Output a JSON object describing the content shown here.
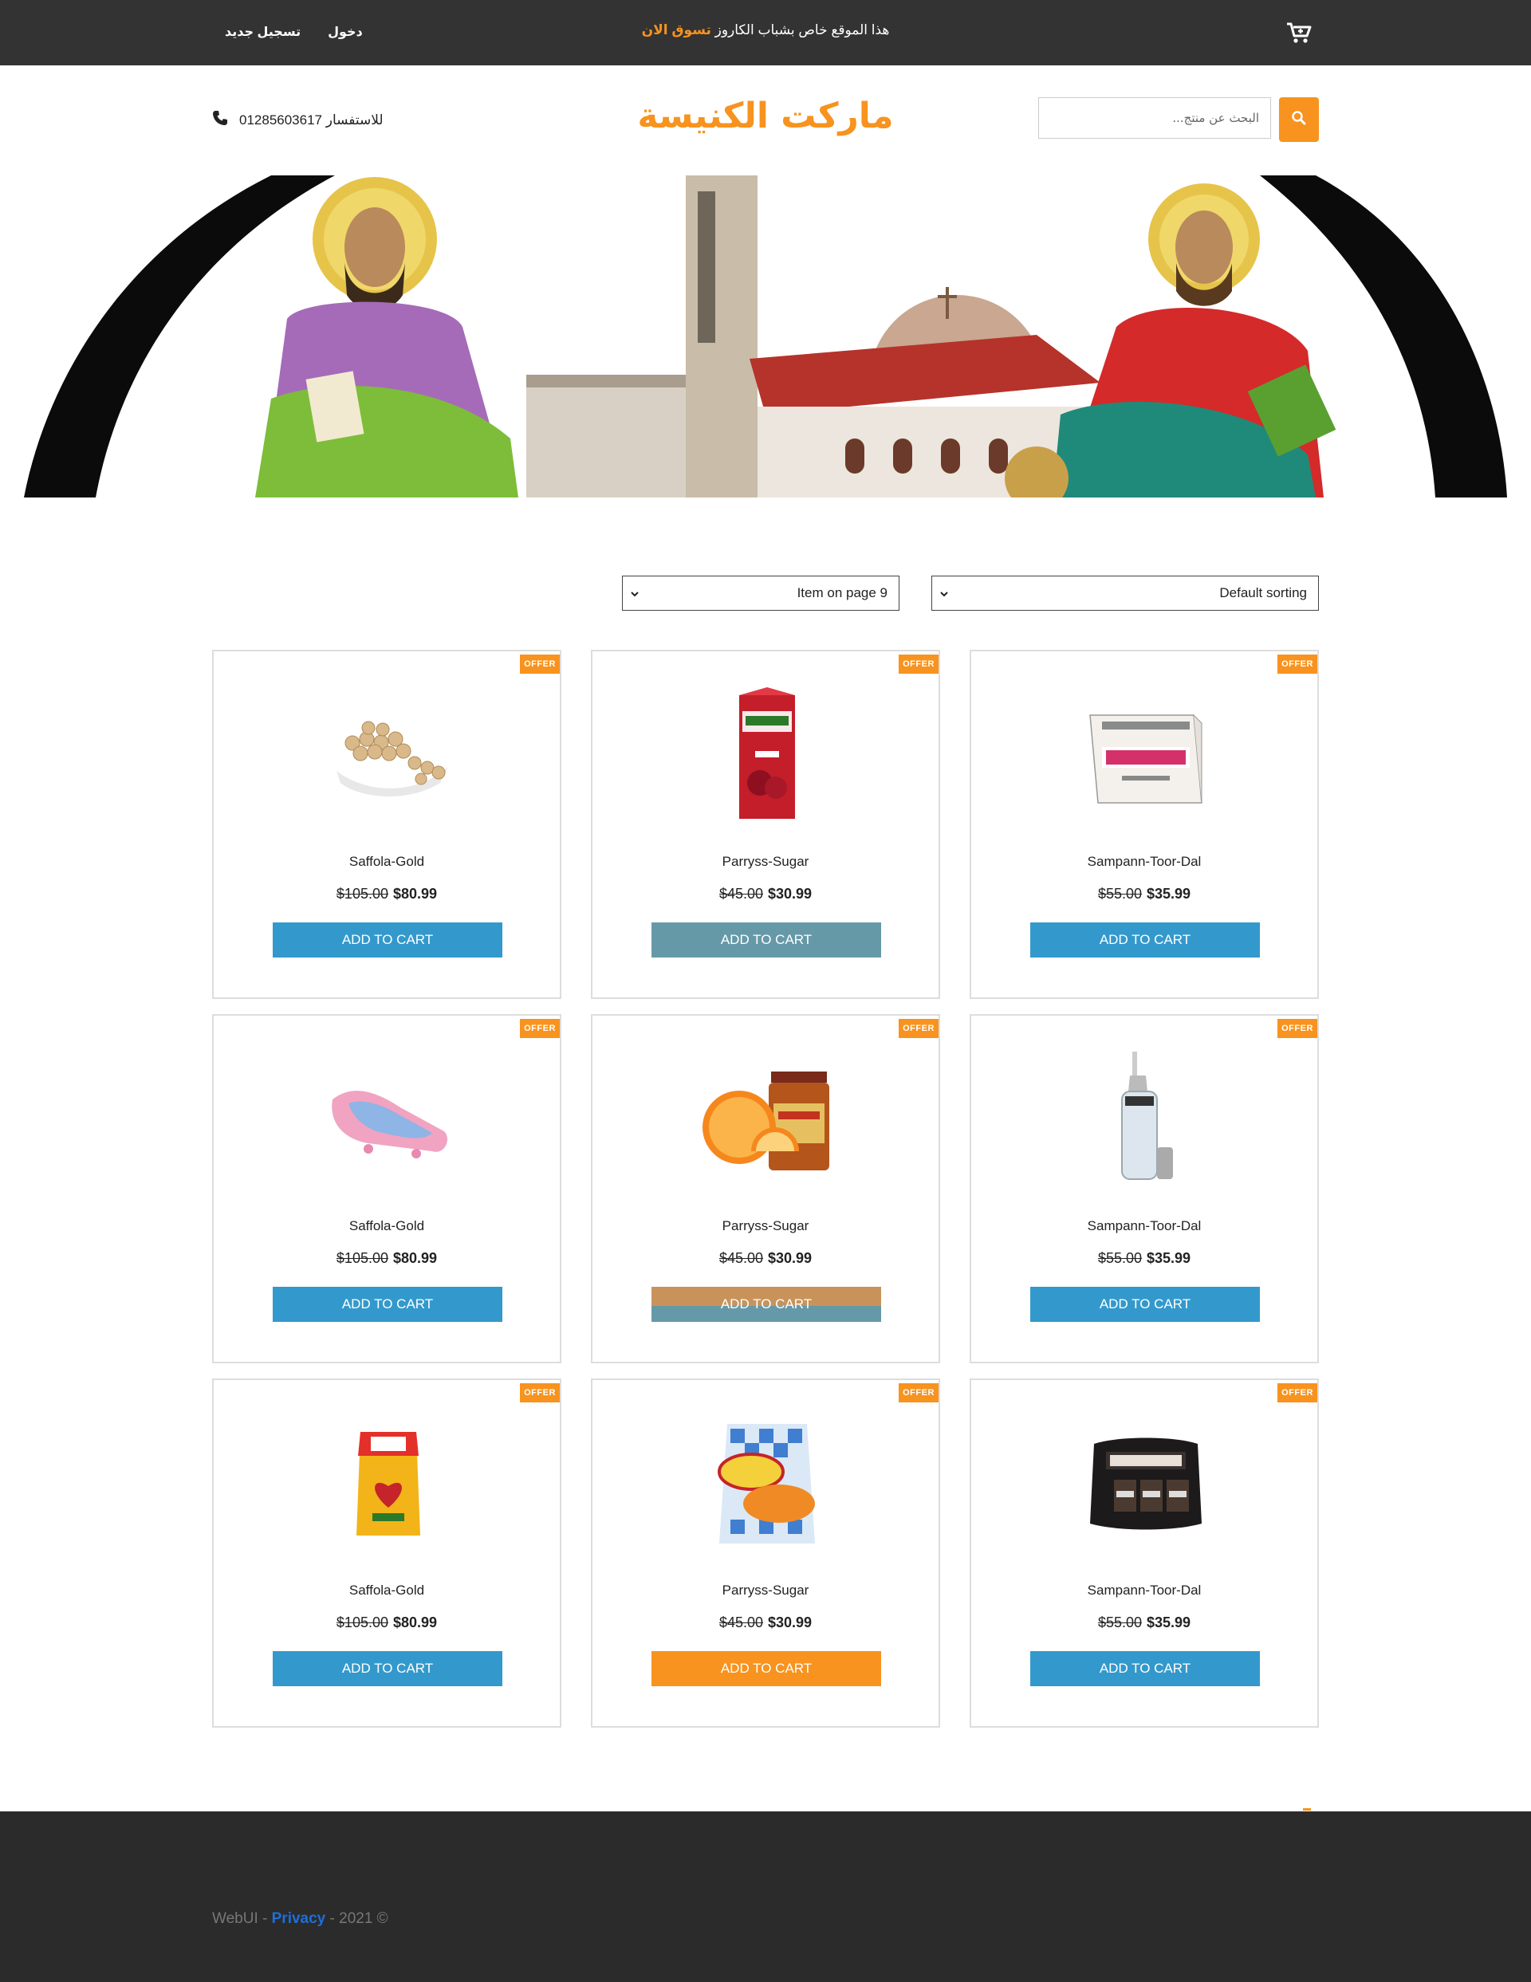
{
  "topbar": {
    "register_label": "تسجيل جديد",
    "login_label": "دخول",
    "promo_text": "هذا الموقع خاص بشباب الكاروز",
    "promo_link": "تسوق الان",
    "cart_icon": "cart-icon"
  },
  "header": {
    "phone_label": "للاستفسار",
    "phone_number": "01285603617",
    "logo_text": "ماركت الكنيسة",
    "search_placeholder": "البحث عن منتج...",
    "search_icon": "search-icon"
  },
  "toolbar": {
    "items_per_page": "Item on page 9",
    "sorting": "Default sorting"
  },
  "colors": {
    "accent": "#f7931e",
    "button_blue": "#3399cc",
    "topbar": "#333333",
    "footer": "#2b2b2b"
  },
  "products": [
    {
      "badge": "OFFER",
      "name": "Saffola-Gold",
      "old_price": "$105.00",
      "new_price": "$80.99",
      "button": "ADD TO CART",
      "image": "chickpeas-bowl"
    },
    {
      "badge": "OFFER",
      "name": "Parryss-Sugar",
      "old_price": "$45.00",
      "new_price": "$30.99",
      "button": "ADD TO CART",
      "image": "tropicana-juice-carton"
    },
    {
      "badge": "OFFER",
      "name": "Sampann-Toor-Dal",
      "old_price": "$55.00",
      "new_price": "$35.99",
      "button": "ADD TO CART",
      "image": "himalayan-box"
    },
    {
      "badge": "OFFER",
      "name": "Saffola-Gold",
      "old_price": "$105.00",
      "new_price": "$80.99",
      "button": "ADD TO CART",
      "image": "baby-bath-seat"
    },
    {
      "badge": "OFFER",
      "name": "Parryss-Sugar",
      "old_price": "$45.00",
      "new_price": "$30.99",
      "button": "ADD TO CART",
      "image": "orange-marmalade-jar"
    },
    {
      "badge": "OFFER",
      "name": "Sampann-Toor-Dal",
      "old_price": "$55.00",
      "new_price": "$35.99",
      "button": "ADD TO CART",
      "image": "oil-dispenser-bottle"
    },
    {
      "badge": "OFFER",
      "name": "Saffola-Gold",
      "old_price": "$105.00",
      "new_price": "$80.99",
      "button": "ADD TO CART",
      "image": "saffola-oil-pouch"
    },
    {
      "badge": "OFFER",
      "name": "Parryss-Sugar",
      "old_price": "$45.00",
      "new_price": "$30.99",
      "button": "ADD TO CART",
      "image": "parrys-sugar-bag"
    },
    {
      "badge": "OFFER",
      "name": "Sampann-Toor-Dal",
      "old_price": "$55.00",
      "new_price": "$35.99",
      "button": "ADD TO CART",
      "image": "hersheys-chocolate-bag"
    }
  ],
  "footer": {
    "brand": "WebUI",
    "sep1": " - ",
    "privacy": "Privacy",
    "tail": " - 2021 ©"
  }
}
